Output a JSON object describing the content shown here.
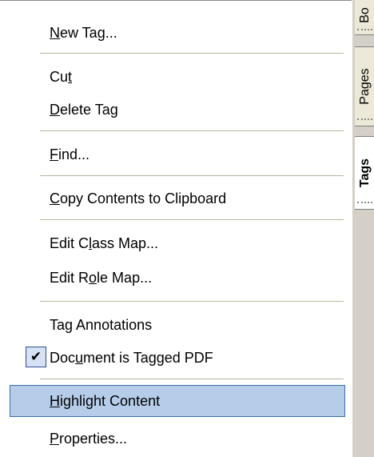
{
  "menu": {
    "items": [
      {
        "before": "",
        "mnemonic": "N",
        "after": "ew Tag..."
      },
      {
        "before": "Cu",
        "mnemonic": "t",
        "after": ""
      },
      {
        "before": "",
        "mnemonic": "D",
        "after": "elete Tag"
      },
      {
        "before": "",
        "mnemonic": "F",
        "after": "ind..."
      },
      {
        "before": "",
        "mnemonic": "C",
        "after": "opy Contents to Clipboard"
      },
      {
        "before": "Edit C",
        "mnemonic": "l",
        "after": "ass Map..."
      },
      {
        "before": "Edit R",
        "mnemonic": "o",
        "after": "le Map..."
      },
      {
        "before": "Ta",
        "mnemonic": "g",
        "after": " Annotations"
      },
      {
        "before": "Doc",
        "mnemonic": "u",
        "after": "ment is Tagged PDF",
        "checked": true
      },
      {
        "before": "",
        "mnemonic": "H",
        "after": "ighlight Content",
        "highlighted": true
      },
      {
        "before": "",
        "mnemonic": "P",
        "after": "roperties..."
      }
    ],
    "check_mark": "✔"
  },
  "side_tabs": [
    {
      "label": "Bo"
    },
    {
      "label": "Pages"
    },
    {
      "label": "Tags",
      "active": true
    }
  ],
  "colors": {
    "highlight_bg": "#b6cdea",
    "highlight_border": "#3a6ea5",
    "panel_bg": "#d4d0c8"
  }
}
